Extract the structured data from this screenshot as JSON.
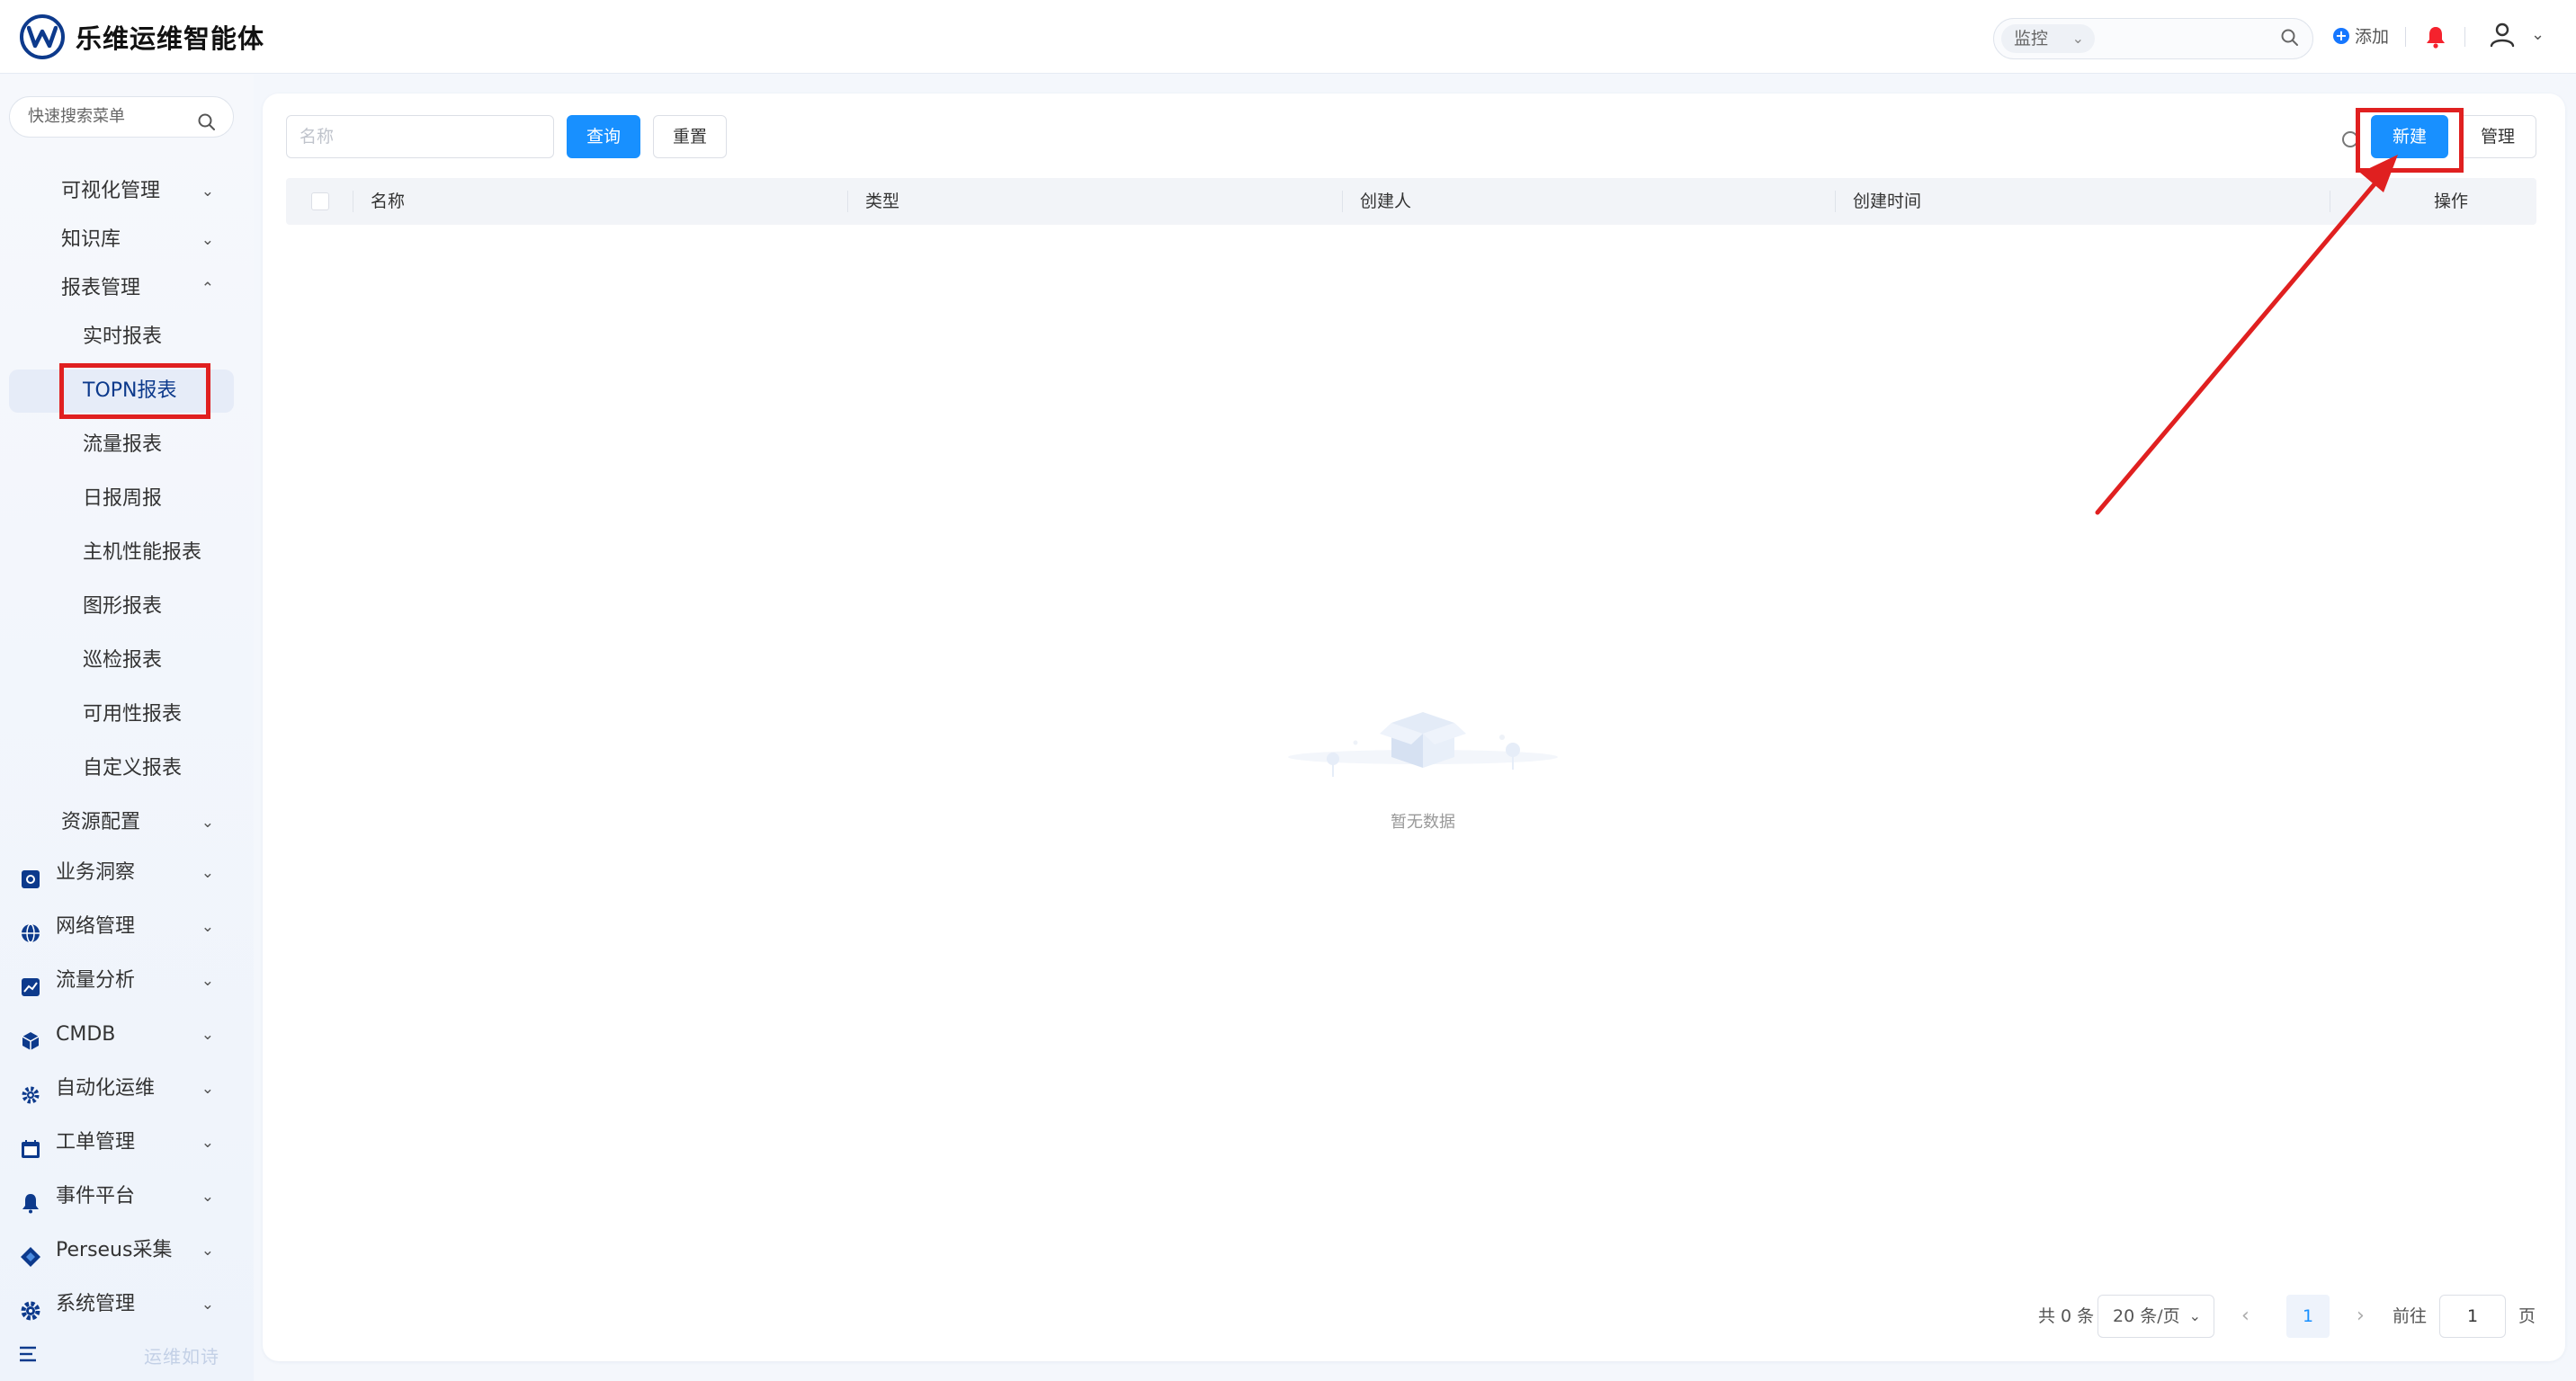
{
  "app": {
    "title": "乐维运维智能体"
  },
  "header": {
    "search_scope": "监控",
    "search_placeholder": "",
    "add_label": "添加"
  },
  "sidebar": {
    "search_placeholder": "快速搜索菜单",
    "items": [
      {
        "label": "可视化管理",
        "level": 2,
        "expanded": false
      },
      {
        "label": "知识库",
        "level": 2,
        "expanded": false
      },
      {
        "label": "报表管理",
        "level": 2,
        "expanded": true
      },
      {
        "label": "实时报表",
        "level": 3
      },
      {
        "label": "TOPN报表",
        "level": 3,
        "active": true
      },
      {
        "label": "流量报表",
        "level": 3
      },
      {
        "label": "日报周报",
        "level": 3
      },
      {
        "label": "主机性能报表",
        "level": 3
      },
      {
        "label": "图形报表",
        "level": 3
      },
      {
        "label": "巡检报表",
        "level": 3
      },
      {
        "label": "可用性报表",
        "level": 3
      },
      {
        "label": "自定义报表",
        "level": 3
      },
      {
        "label": "资源配置",
        "level": 2,
        "expanded": false
      },
      {
        "label": "业务洞察",
        "level": 1,
        "icon": "business-insight-icon"
      },
      {
        "label": "网络管理",
        "level": 1,
        "icon": "globe-icon"
      },
      {
        "label": "流量分析",
        "level": 1,
        "icon": "traffic-chart-icon"
      },
      {
        "label": "CMDB",
        "level": 1,
        "icon": "cube-icon"
      },
      {
        "label": "自动化运维",
        "level": 1,
        "icon": "gear-icon"
      },
      {
        "label": "工单管理",
        "level": 1,
        "icon": "calendar-icon"
      },
      {
        "label": "事件平台",
        "level": 1,
        "icon": "bell-icon"
      },
      {
        "label": "Perseus采集",
        "level": 1,
        "icon": "diamond-icon"
      },
      {
        "label": "系统管理",
        "level": 1,
        "icon": "settings-icon"
      }
    ],
    "slogan": "运维如诗"
  },
  "toolbar": {
    "name_placeholder": "名称",
    "query_label": "查询",
    "reset_label": "重置",
    "new_label": "新建",
    "manage_label": "管理"
  },
  "table": {
    "columns": [
      "名称",
      "类型",
      "创建人",
      "创建时间",
      "操作"
    ],
    "rows": [],
    "empty_text": "暂无数据"
  },
  "pagination": {
    "total_text": "共 0 条",
    "page_size": "20 条/页",
    "current_page": "1",
    "goto_label": "前往",
    "goto_value": "1",
    "page_suffix": "页"
  },
  "colors": {
    "primary": "#1890ff",
    "brand": "#0d3a8c",
    "annotation": "#e02020",
    "notification": "#f5222d"
  }
}
